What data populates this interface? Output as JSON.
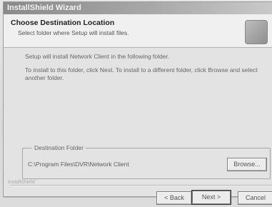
{
  "window": {
    "title": "InstallShield Wizard"
  },
  "header": {
    "title": "Choose Destination Location",
    "subtitle": "Select folder where Setup will install files."
  },
  "body": {
    "line1": "Setup will install Network Client in the following folder.",
    "line2": "To install to this folder, click Next. To install to a different folder, click Browse and select another folder."
  },
  "destination": {
    "label": "Destination Folder",
    "path": "C:\\Program Files\\DVR\\Network Client",
    "browse_label": "Browse..."
  },
  "footer": {
    "brand": "InstallShield",
    "back_label": "< Back",
    "next_label": "Next >",
    "cancel_label": "Cancel"
  },
  "icons": {
    "header_icon": "setup-computer-icon"
  }
}
